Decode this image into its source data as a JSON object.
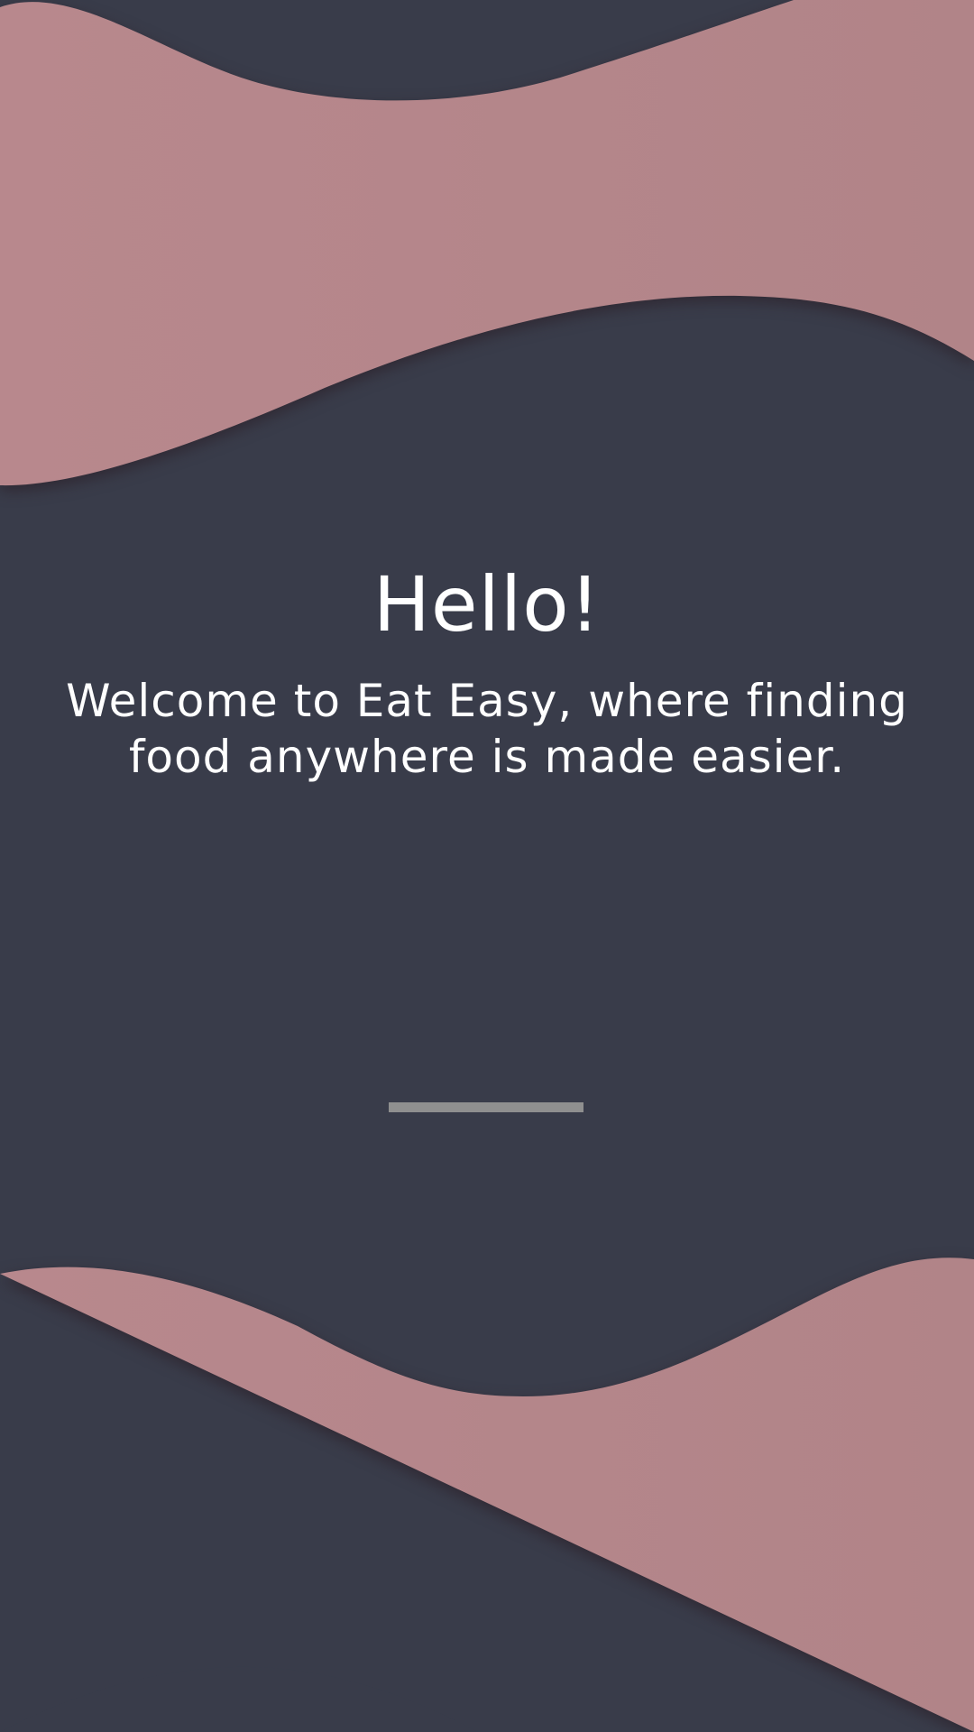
{
  "welcome": {
    "title": "Hello!",
    "subtitle": "Welcome to Eat Easy, where finding food anywhere is made easier."
  },
  "colors": {
    "background": "#393c4a",
    "wave": "#b38589",
    "text": "#ffffff",
    "progress_bar": "#8f8f8f"
  }
}
